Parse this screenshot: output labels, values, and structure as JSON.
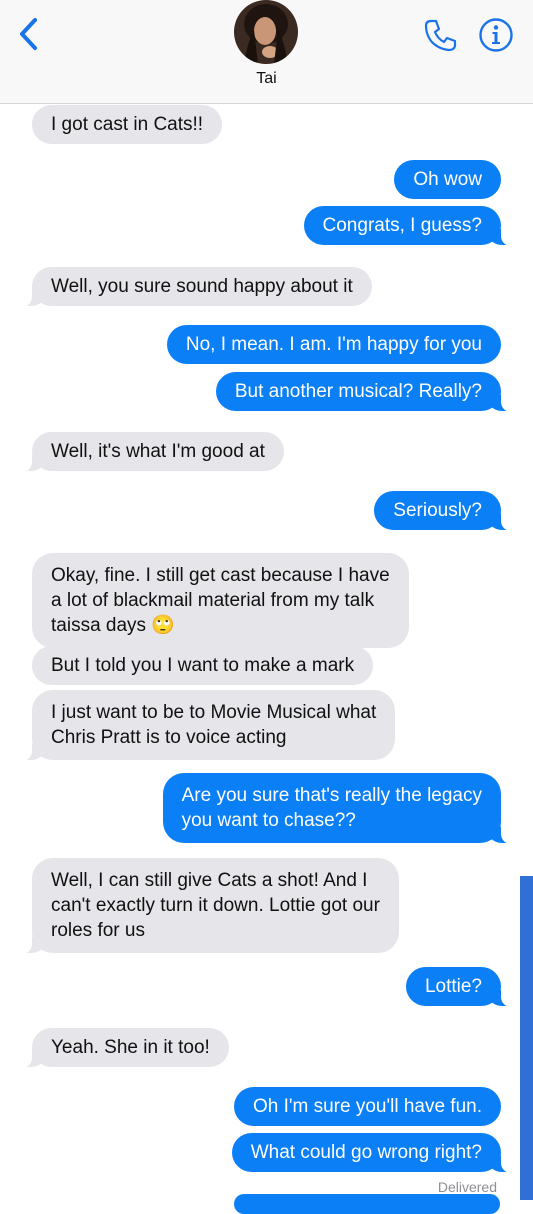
{
  "header": {
    "contact_name": "Tai",
    "back_icon": "chevron-left-icon",
    "call_icon": "phone-icon",
    "info_icon": "info-icon",
    "accent_color": "#1a73e8"
  },
  "messages": [
    {
      "from": "them",
      "text": "I got cast in Cats!!"
    },
    {
      "from": "me",
      "text": "Oh wow"
    },
    {
      "from": "me",
      "text": "Congrats, I guess?"
    },
    {
      "from": "them",
      "text": "Well, you sure sound happy about it"
    },
    {
      "from": "me",
      "text": "No, I mean. I am. I'm happy for you"
    },
    {
      "from": "me",
      "text": "But another musical? Really?"
    },
    {
      "from": "them",
      "text": "Well, it's what I'm good at"
    },
    {
      "from": "me",
      "text": "Seriously?"
    },
    {
      "from": "them",
      "lines": [
        "Okay, fine. I still get cast because I have",
        "a lot of blackmail material from my talk",
        "taissa days 🙄"
      ]
    },
    {
      "from": "them",
      "text": "But I told you I want to make a mark"
    },
    {
      "from": "them",
      "lines": [
        "I just want to be to Movie Musical what",
        "Chris Pratt is to voice acting"
      ]
    },
    {
      "from": "me",
      "lines": [
        "Are you sure that's really the legacy",
        "you want to chase??"
      ]
    },
    {
      "from": "them",
      "lines": [
        "Well, I can still give Cats a shot! And I",
        "can't exactly turn it down. Lottie got our",
        "roles for us"
      ]
    },
    {
      "from": "me",
      "text": "Lottie?"
    },
    {
      "from": "them",
      "text": "Yeah. She in it too!"
    },
    {
      "from": "me",
      "text": "Oh I'm sure you'll have fun."
    },
    {
      "from": "me",
      "text": "What could go wrong right?"
    }
  ],
  "status": {
    "delivered": "Delivered"
  },
  "colors": {
    "incoming_bubble": "#e5e5ea",
    "outgoing_bubble": "#0b7ff5"
  }
}
